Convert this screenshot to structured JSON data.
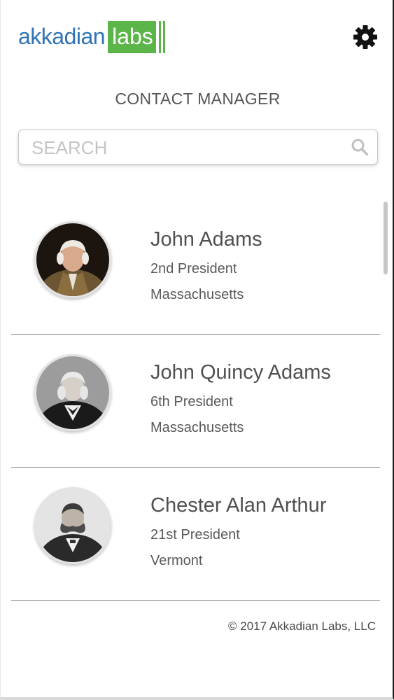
{
  "header": {
    "logo_primary": "akkadian",
    "logo_secondary": "labs",
    "settings_icon": "gear-icon"
  },
  "page_title": "CONTACT MANAGER",
  "search": {
    "placeholder": "SEARCH",
    "value": "",
    "icon": "search-icon"
  },
  "contacts": [
    {
      "name": "John Adams",
      "office": "2nd President",
      "state": "Massachusetts"
    },
    {
      "name": "John Quincy Adams",
      "office": "6th President",
      "state": "Massachusetts"
    },
    {
      "name": "Chester Alan Arthur",
      "office": "21st President",
      "state": "Vermont"
    }
  ],
  "footer": {
    "copyright": "© 2017 Akkadian Labs, LLC"
  },
  "colors": {
    "brand_blue": "#2f74b5",
    "brand_green": "#5cb548",
    "text": "#4a4a4a",
    "divider": "#8f8f8f"
  }
}
